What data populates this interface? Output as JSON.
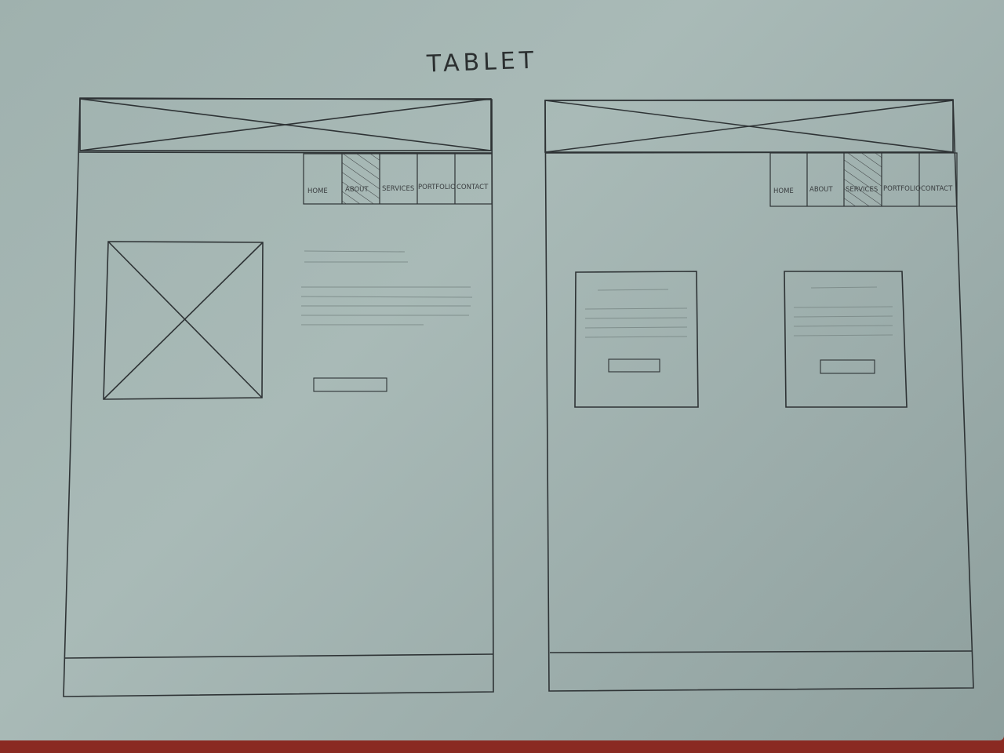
{
  "title": "TABLET",
  "frames": [
    {
      "id": "about-page",
      "nav": {
        "items": [
          "HOME",
          "ABOUT",
          "SERVICES",
          "PORTFOLIO",
          "CONTACT"
        ],
        "active_index": 1
      }
    },
    {
      "id": "services-page",
      "nav": {
        "items": [
          "HOME",
          "ABOUT",
          "SERVICES",
          "PORTFOLIO",
          "CONTACT"
        ],
        "active_index": 2
      }
    }
  ],
  "colors": {
    "paper": "#a9bab7",
    "ink": "#2e3335",
    "faint_ink": "#7f8e8c",
    "background": "#8a2a22"
  }
}
